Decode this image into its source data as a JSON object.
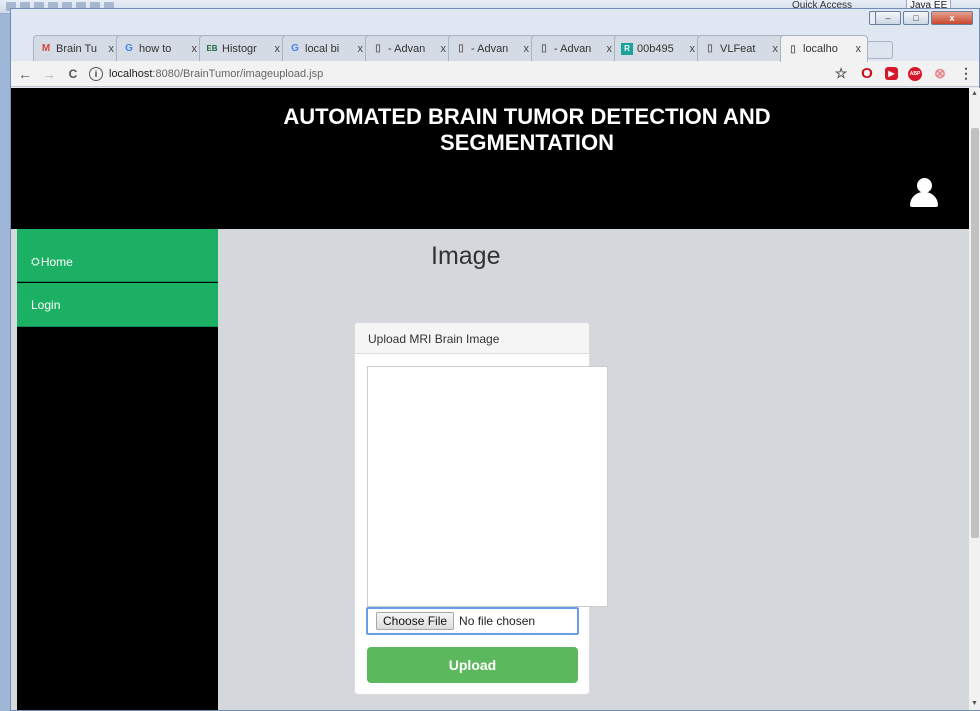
{
  "os": {
    "quick_access": "Quick Access",
    "perspective": "Java EE"
  },
  "browser": {
    "window_controls": {
      "minimize": "–",
      "maximize": "□",
      "close": "x"
    },
    "tabs": [
      {
        "favicon": "M",
        "favicon_color": "#d44638",
        "title": "Brain Tu",
        "close": "x"
      },
      {
        "favicon": "G",
        "favicon_color": "#4285f4",
        "title": "how to",
        "close": "x"
      },
      {
        "favicon": "EB",
        "favicon_color": "#1d6b3a",
        "title": "Histogr",
        "close": "x"
      },
      {
        "favicon": "G",
        "favicon_color": "#4285f4",
        "title": "local bi",
        "close": "x"
      },
      {
        "favicon": "▯",
        "favicon_color": "#666666",
        "title": "- Advan",
        "close": "x"
      },
      {
        "favicon": "▯",
        "favicon_color": "#666666",
        "title": "- Advan",
        "close": "x"
      },
      {
        "favicon": "▯",
        "favicon_color": "#666666",
        "title": "- Advan",
        "close": "x"
      },
      {
        "favicon": "R",
        "favicon_color": "#19a19a",
        "title": "00b495",
        "close": "x"
      },
      {
        "favicon": "▯",
        "favicon_color": "#666666",
        "title": "VLFeat",
        "close": "x"
      },
      {
        "favicon": "▯",
        "favicon_color": "#666666",
        "title": "localho",
        "close": "x"
      }
    ],
    "nav": {
      "back": "←",
      "forward": "→",
      "reload": "C",
      "info": "i"
    },
    "url": {
      "host": "localhost",
      "path": ":8080/BrainTumor/imageupload.jsp"
    },
    "extensions": {
      "star": "☆",
      "opera": "O",
      "rec": "▶",
      "abp": "ABP",
      "ring": "⊗",
      "menu": "⋮"
    }
  },
  "page": {
    "header_title": "AUTOMATED BRAIN TUMOR DETECTION AND SEGMENTATION",
    "sidebar": [
      {
        "icon": "⛭",
        "label": "Home"
      },
      {
        "icon": "",
        "label": "Login"
      }
    ],
    "content_title": "Image",
    "panel": {
      "heading": "Upload MRI Brain Image",
      "file_button": "Choose File",
      "file_status": "No file chosen",
      "upload_button": "Upload"
    }
  },
  "colors": {
    "accent_green": "#1cb065",
    "upload_green": "#5cb85c",
    "header_black": "#000000"
  }
}
